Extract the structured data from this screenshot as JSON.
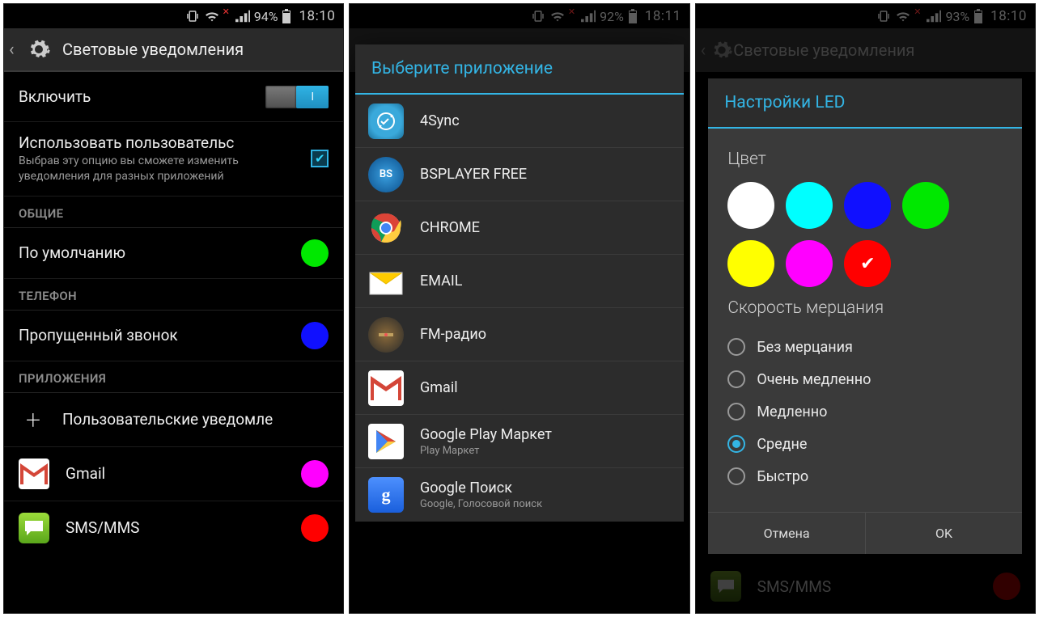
{
  "status": {
    "p1": {
      "battery": "94%",
      "time": "18:10"
    },
    "p2": {
      "battery": "92%",
      "time": "18:11"
    },
    "p3": {
      "battery": "93%",
      "time": "18:10"
    }
  },
  "screen1": {
    "title": "Световые уведомления",
    "enable": "Включить",
    "custom_title": "Использовать пользовательс",
    "custom_sub": "Выбрав эту опцию вы сможете изменить уведомления для разных приложений",
    "sect_general": "ОБЩИЕ",
    "default": "По умолчанию",
    "sect_phone": "ТЕЛЕФОН",
    "missed": "Пропущенный звонок",
    "sect_apps": "ПРИЛОЖЕНИЯ",
    "add": "Пользовательские уведомле",
    "apps": [
      {
        "name": "Gmail",
        "color": "#ff00ff"
      },
      {
        "name": "SMS/MMS",
        "color": "#ff0000"
      }
    ],
    "default_color": "#00e800",
    "missed_color": "#1010ff"
  },
  "screen2": {
    "dialog_title": "Выберите приложение",
    "apps": [
      {
        "name": "4Sync",
        "sub": ""
      },
      {
        "name": "BSPLAYER FREE",
        "sub": ""
      },
      {
        "name": "CHROME",
        "sub": ""
      },
      {
        "name": "EMAIL",
        "sub": ""
      },
      {
        "name": "FM-радио",
        "sub": ""
      },
      {
        "name": "Gmail",
        "sub": ""
      },
      {
        "name": "Google Play Маркет",
        "sub": "Play Маркет"
      },
      {
        "name": "Google Поиск",
        "sub": "Google, Голосовой поиск"
      }
    ]
  },
  "screen3": {
    "bg_title": "Световые уведомления",
    "dialog_title": "Настройки LED",
    "color_label": "Цвет",
    "colors": [
      "#ffffff",
      "#00ffff",
      "#1010ff",
      "#00e800",
      "#ffff00",
      "#ff00ff",
      "#ff0000"
    ],
    "selected_color_index": 6,
    "speed_label": "Скорость мерцания",
    "speeds": [
      "Без мерцания",
      "Очень медленно",
      "Медленно",
      "Средне",
      "Быстро"
    ],
    "selected_speed_index": 3,
    "cancel": "Отмена",
    "ok": "OK",
    "bg_sms": "SMS/MMS"
  }
}
